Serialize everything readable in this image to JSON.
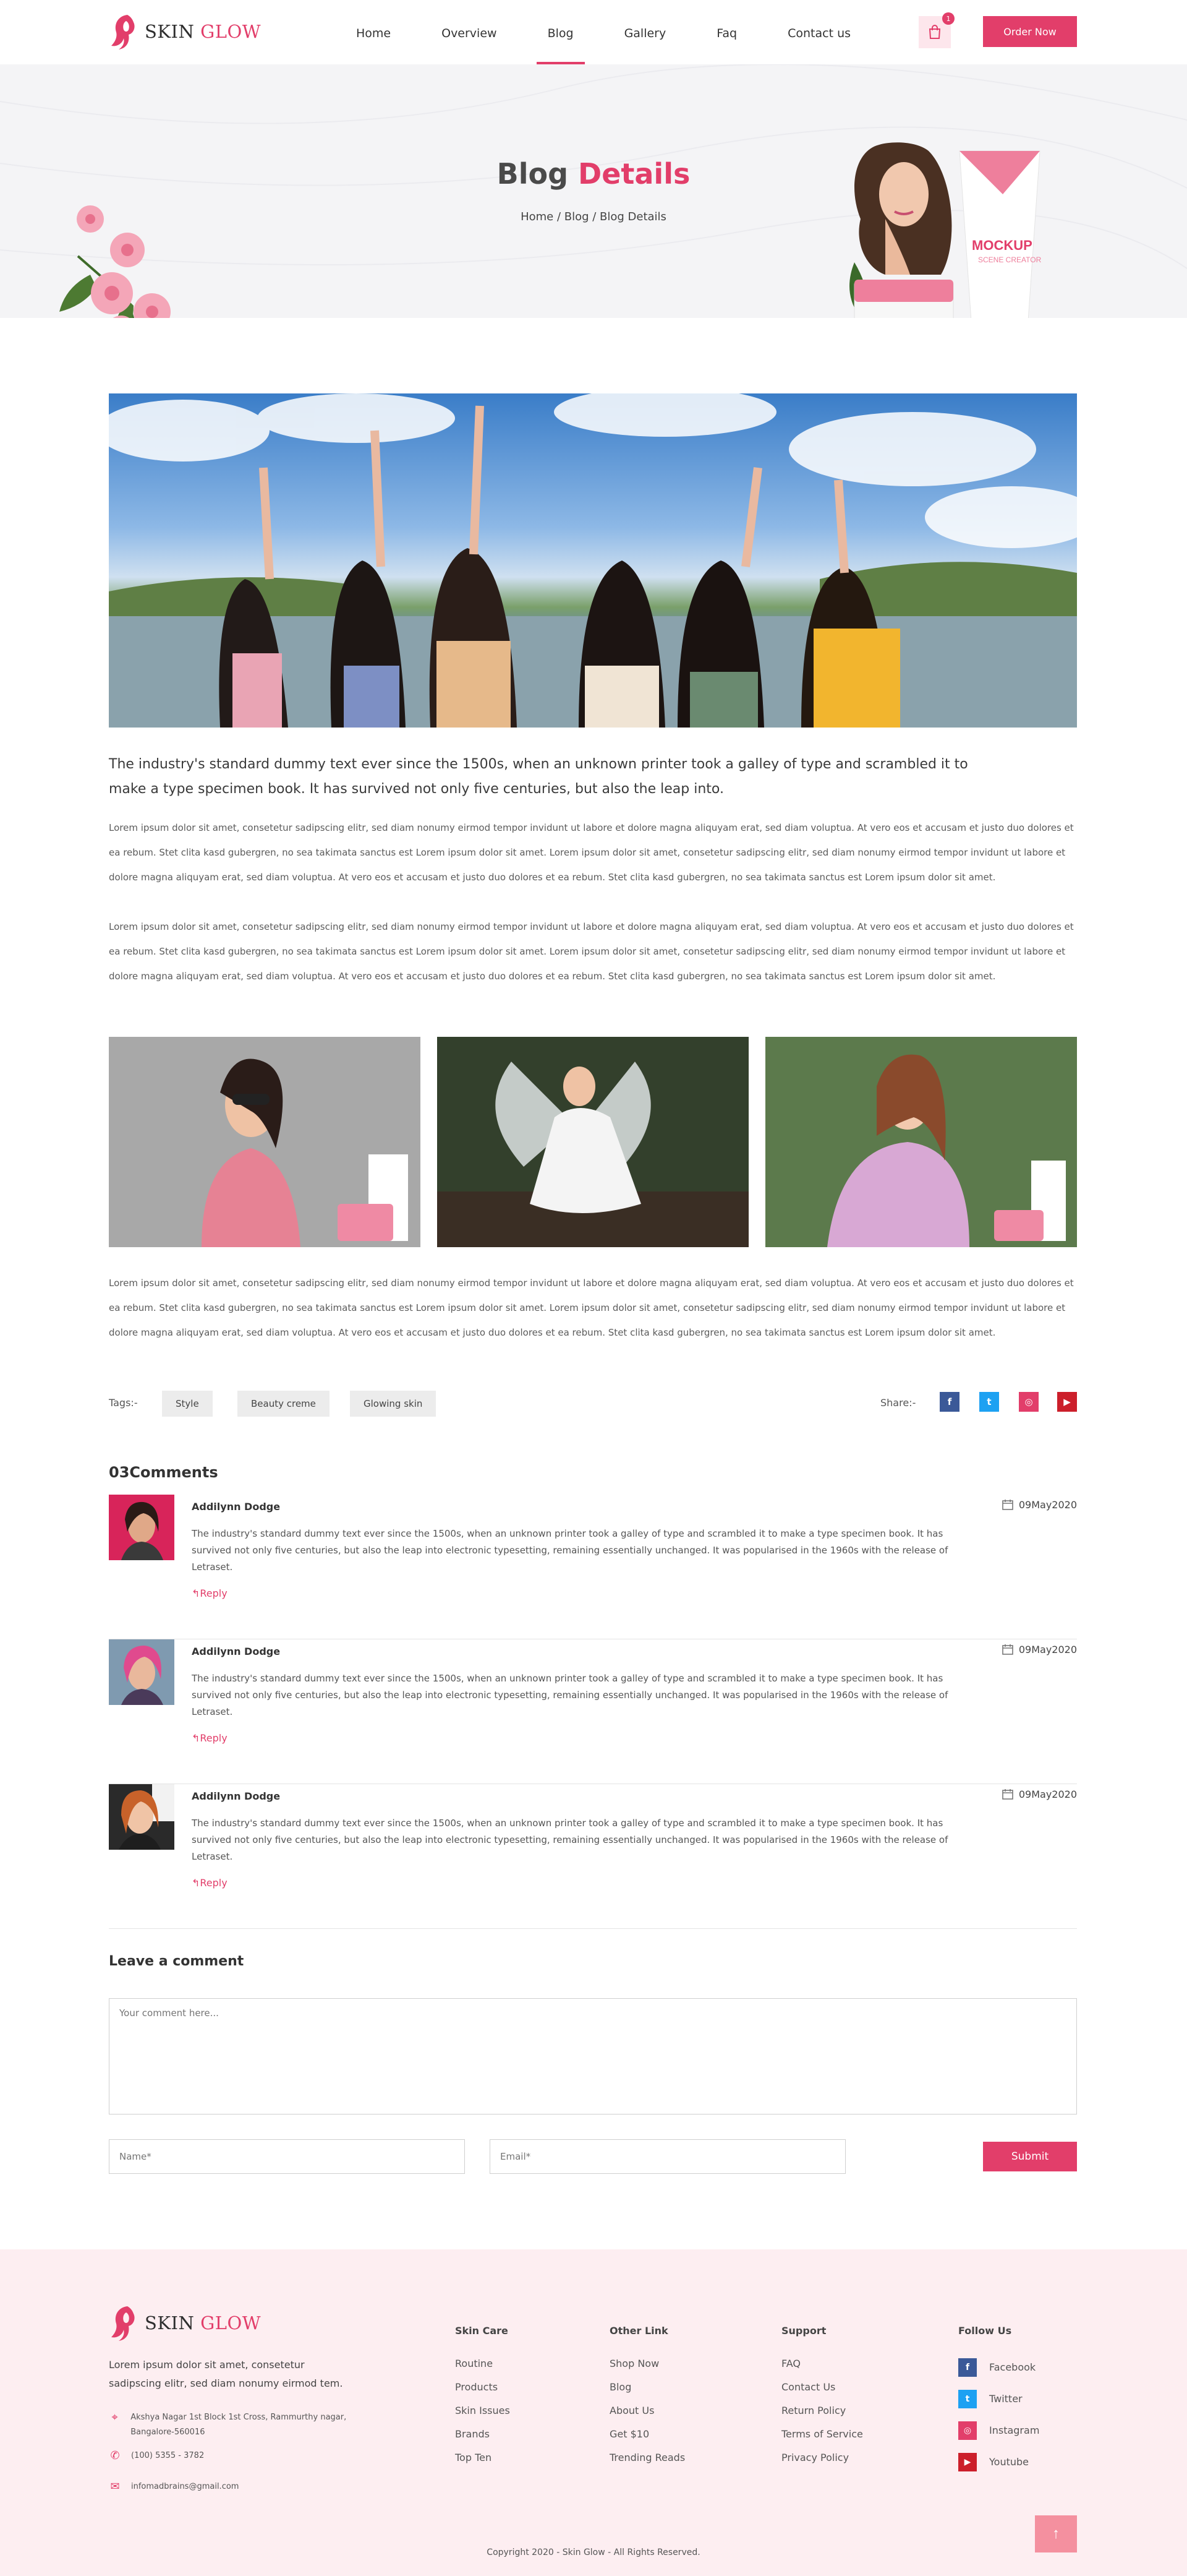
{
  "brand": {
    "name_part1": "SKIN",
    "name_part2": "GLOW",
    "accent": "#e23e6a"
  },
  "nav": {
    "items": [
      {
        "label": "Home"
      },
      {
        "label": "Overview"
      },
      {
        "label": "Blog",
        "active": true
      },
      {
        "label": "Gallery"
      },
      {
        "label": "Faq"
      },
      {
        "label": "Contact us"
      }
    ],
    "cart_count": "1",
    "order_label": "Order Now"
  },
  "banner": {
    "title_part1": "Blog",
    "title_part2": "Details",
    "breadcrumb": "Home / Blog / Blog Details",
    "product_label": "MOCKUP",
    "product_sub": "SCENE CREATOR"
  },
  "article": {
    "lead": "The industry's standard dummy text ever since the 1500s, when an unknown printer took a galley of type and scrambled it to make a type specimen book. It has survived not only five centuries, but also the leap into.",
    "para1": "Lorem ipsum dolor sit amet, consetetur sadipscing elitr, sed diam nonumy eirmod tempor invidunt ut labore et dolore magna aliquyam erat, sed diam voluptua. At vero eos et accusam et justo duo dolores et ea rebum. Stet clita kasd gubergren, no sea takimata sanctus est Lorem ipsum dolor sit amet. Lorem ipsum dolor sit amet, consetetur sadipscing elitr, sed diam nonumy eirmod tempor invidunt ut labore et dolore magna aliquyam erat, sed diam voluptua. At vero eos et accusam et justo duo dolores et ea rebum. Stet clita kasd gubergren, no sea takimata sanctus est Lorem ipsum dolor sit amet.",
    "para2": "Lorem ipsum dolor sit amet, consetetur sadipscing elitr, sed diam nonumy eirmod tempor invidunt ut labore et dolore magna aliquyam erat, sed diam voluptua. At vero eos et accusam et justo duo dolores et ea rebum. Stet clita kasd gubergren, no sea takimata sanctus est Lorem ipsum dolor sit amet. Lorem ipsum dolor sit amet, consetetur sadipscing elitr, sed diam nonumy eirmod tempor invidunt ut labore et dolore magna aliquyam erat, sed diam voluptua. At vero eos et accusam et justo duo dolores et ea rebum. Stet clita kasd gubergren, no sea takimata sanctus est Lorem ipsum dolor sit amet.",
    "para3": "Lorem ipsum dolor sit amet, consetetur sadipscing elitr, sed diam nonumy eirmod tempor invidunt ut labore et dolore magna aliquyam erat, sed diam voluptua. At vero eos et accusam et justo duo dolores et ea rebum. Stet clita kasd gubergren, no sea takimata sanctus est Lorem ipsum dolor sit amet. Lorem ipsum dolor sit amet, consetetur sadipscing elitr, sed diam nonumy eirmod tempor invidunt ut labore et dolore magna aliquyam erat, sed diam voluptua. At vero eos et accusam et justo duo dolores et ea rebum. Stet clita kasd gubergren, no sea takimata sanctus est Lorem ipsum dolor sit amet.",
    "tags_label": "Tags:-",
    "tags": [
      "Style",
      "Beauty creme",
      "Glowing skin"
    ],
    "share_label": "Share:-",
    "share": [
      {
        "icon": "facebook-icon",
        "glyph": "f",
        "color": "#3b5998"
      },
      {
        "icon": "twitter-icon",
        "glyph": "t",
        "color": "#1da1f2"
      },
      {
        "icon": "instagram-icon",
        "glyph": "◎",
        "color": "#e23e6a"
      },
      {
        "icon": "youtube-icon",
        "glyph": "▶",
        "color": "#cc1f2b"
      }
    ]
  },
  "comments": {
    "title": "03Comments",
    "items": [
      {
        "name": "Addilynn Dodge",
        "date": "09May2020",
        "text": "The industry's standard dummy text ever since the 1500s, when an unknown printer took a galley of type and scrambled it to make a type specimen book. It has survived not only five centuries, but also the leap into electronic typesetting, remaining essentially unchanged. It was popularised in the 1960s with the release of Letraset.",
        "reply": "Reply"
      },
      {
        "name": "Addilynn Dodge",
        "date": "09May2020",
        "text": "The industry's standard dummy text ever since the 1500s, when an unknown printer took a galley of type and scrambled it to make a type specimen book. It has survived not only five centuries, but also the leap into electronic typesetting, remaining essentially unchanged. It was popularised in the 1960s with the release of Letraset.",
        "reply": "Reply"
      },
      {
        "name": "Addilynn Dodge",
        "date": "09May2020",
        "text": "The industry's standard dummy text ever since the 1500s, when an unknown printer took a galley of type and scrambled it to make a type specimen book. It has survived not only five centuries, but also the leap into electronic typesetting, remaining essentially unchanged. It was popularised in the 1960s with the release of Letraset.",
        "reply": "Reply"
      }
    ]
  },
  "comment_form": {
    "title": "Leave a comment",
    "comment_placeholder": "Your comment here...",
    "name_placeholder": "Name*",
    "email_placeholder": "Email*",
    "submit_label": "Submit"
  },
  "footer": {
    "about": "Lorem ipsum dolor sit amet, consetetur sadipscing elitr, sed diam nonumy eirmod tem.",
    "address": "Akshya Nagar 1st Block 1st Cross, Rammurthy nagar, Bangalore-560016",
    "phone": "(100) 5355 - 3782",
    "email": "infomadbrains@gmail.com",
    "columns": [
      {
        "title": "Skin Care",
        "links": [
          "Routine",
          "Products",
          "Skin Issues",
          "Brands",
          "Top Ten"
        ]
      },
      {
        "title": "Other Link",
        "links": [
          "Shop Now",
          "Blog",
          "About Us",
          "Get $10",
          "Trending Reads"
        ]
      },
      {
        "title": "Support",
        "links": [
          "FAQ",
          "Contact Us",
          "Return Policy",
          "Terms of Service",
          "Privacy Policy"
        ]
      }
    ],
    "follow_title": "Follow Us",
    "follow": [
      {
        "label": "Facebook",
        "icon": "facebook-icon",
        "glyph": "f",
        "color": "#3b5998"
      },
      {
        "label": "Twitter",
        "icon": "twitter-icon",
        "glyph": "t",
        "color": "#1da1f2"
      },
      {
        "label": "Instagram",
        "icon": "instagram-icon",
        "glyph": "◎",
        "color": "#e23e6a"
      },
      {
        "label": "Youtube",
        "icon": "youtube-icon",
        "glyph": "▶",
        "color": "#cc1f2b"
      }
    ],
    "to_top": "↑",
    "copyright": "Copyright 2020 - Skin Glow - All Rights Reserved."
  }
}
